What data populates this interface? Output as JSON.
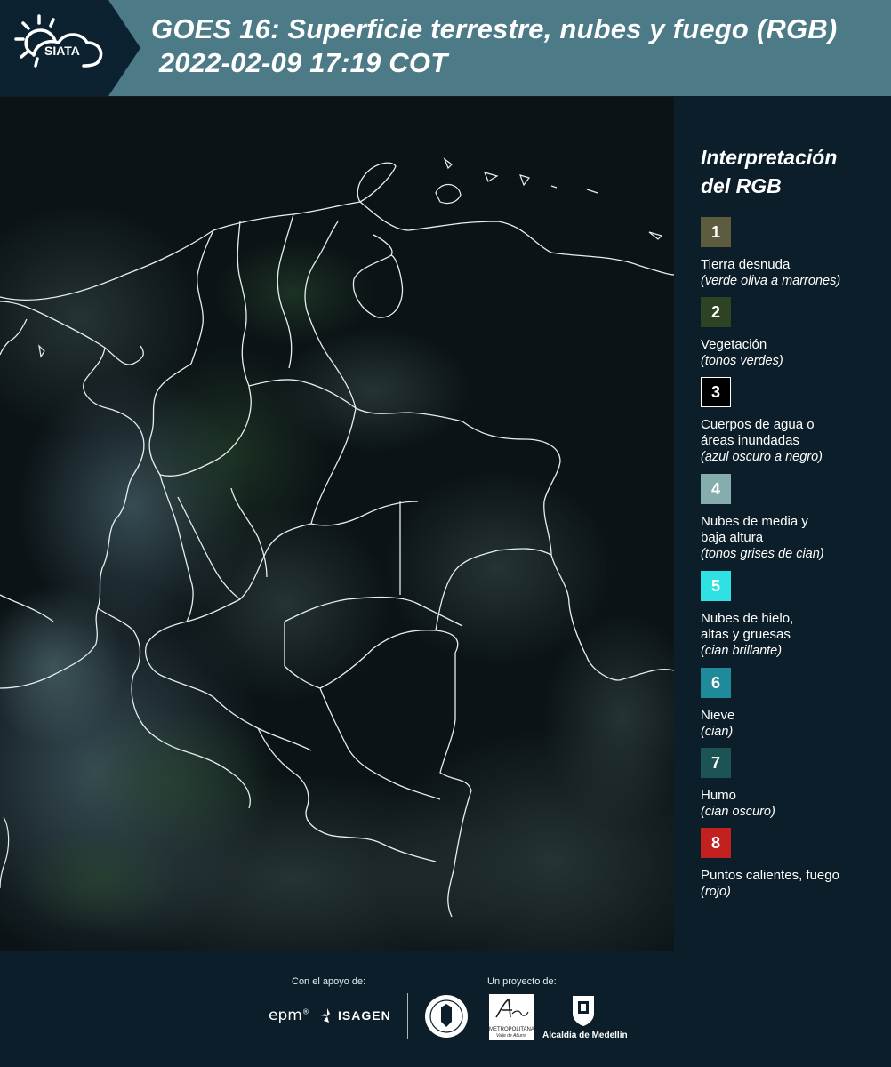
{
  "header": {
    "logo_text": "SIATA",
    "title_line1": "GOES 16: Superficie terrestre, nubes y fuego (RGB)",
    "title_line2": " 2022-02-09 17:19 COT"
  },
  "legend": {
    "title_line1": "Interpretación",
    "title_line2": "del RGB",
    "items": [
      {
        "number": "1",
        "color": "#5d5c3f",
        "label": "Tierra desnuda",
        "desc": "(verde oliva a marrones)"
      },
      {
        "number": "2",
        "color": "#2e4324",
        "label": "Vegetación",
        "desc": "(tonos verdes)"
      },
      {
        "number": "3",
        "color": "#000000",
        "label_line1": "Cuerpos de agua o",
        "label_line2": "áreas inundadas",
        "desc": "(azul oscuro a negro)"
      },
      {
        "number": "4",
        "color": "#86adae",
        "label_line1": "Nubes de media y",
        "label_line2": "baja altura",
        "desc": "(tonos grises de cian)"
      },
      {
        "number": "5",
        "color": "#2fe1e2",
        "label_line1": "Nubes de hielo,",
        "label_line2": "altas y gruesas",
        "desc": "(cian brillante)"
      },
      {
        "number": "6",
        "color": "#1f8a9a",
        "label": "Nieve",
        "desc": "(cian)"
      },
      {
        "number": "7",
        "color": "#1c5454",
        "label": "Humo",
        "desc": "(cian oscuro)"
      },
      {
        "number": "8",
        "color": "#c32020",
        "label": "Puntos calientes, fuego",
        "desc": "(rojo)"
      }
    ]
  },
  "footer": {
    "support_label": "Con el apoyo de:",
    "project_label": "Un proyecto de:",
    "epm": "epm",
    "isagen": "ISAGEN",
    "area_line1": "METROPOLITANA",
    "area_line2": "Valle de Aburrá",
    "alcaldia": "Alcaldía de Medellín"
  }
}
